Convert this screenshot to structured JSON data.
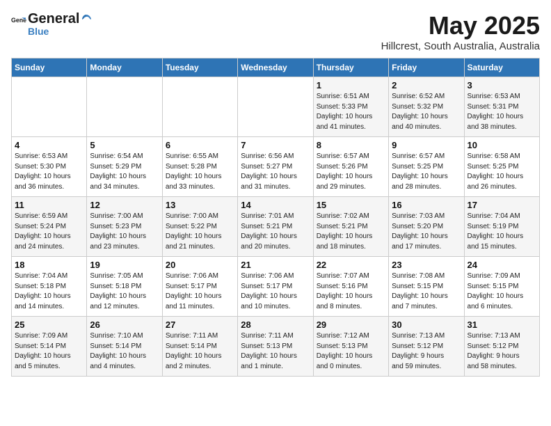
{
  "logo": {
    "text_general": "General",
    "text_blue": "Blue"
  },
  "header": {
    "month_title": "May 2025",
    "subtitle": "Hillcrest, South Australia, Australia"
  },
  "days_of_week": [
    "Sunday",
    "Monday",
    "Tuesday",
    "Wednesday",
    "Thursday",
    "Friday",
    "Saturday"
  ],
  "weeks": [
    [
      {
        "day": "",
        "info": ""
      },
      {
        "day": "",
        "info": ""
      },
      {
        "day": "",
        "info": ""
      },
      {
        "day": "",
        "info": ""
      },
      {
        "day": "1",
        "info": "Sunrise: 6:51 AM\nSunset: 5:33 PM\nDaylight: 10 hours\nand 41 minutes."
      },
      {
        "day": "2",
        "info": "Sunrise: 6:52 AM\nSunset: 5:32 PM\nDaylight: 10 hours\nand 40 minutes."
      },
      {
        "day": "3",
        "info": "Sunrise: 6:53 AM\nSunset: 5:31 PM\nDaylight: 10 hours\nand 38 minutes."
      }
    ],
    [
      {
        "day": "4",
        "info": "Sunrise: 6:53 AM\nSunset: 5:30 PM\nDaylight: 10 hours\nand 36 minutes."
      },
      {
        "day": "5",
        "info": "Sunrise: 6:54 AM\nSunset: 5:29 PM\nDaylight: 10 hours\nand 34 minutes."
      },
      {
        "day": "6",
        "info": "Sunrise: 6:55 AM\nSunset: 5:28 PM\nDaylight: 10 hours\nand 33 minutes."
      },
      {
        "day": "7",
        "info": "Sunrise: 6:56 AM\nSunset: 5:27 PM\nDaylight: 10 hours\nand 31 minutes."
      },
      {
        "day": "8",
        "info": "Sunrise: 6:57 AM\nSunset: 5:26 PM\nDaylight: 10 hours\nand 29 minutes."
      },
      {
        "day": "9",
        "info": "Sunrise: 6:57 AM\nSunset: 5:25 PM\nDaylight: 10 hours\nand 28 minutes."
      },
      {
        "day": "10",
        "info": "Sunrise: 6:58 AM\nSunset: 5:25 PM\nDaylight: 10 hours\nand 26 minutes."
      }
    ],
    [
      {
        "day": "11",
        "info": "Sunrise: 6:59 AM\nSunset: 5:24 PM\nDaylight: 10 hours\nand 24 minutes."
      },
      {
        "day": "12",
        "info": "Sunrise: 7:00 AM\nSunset: 5:23 PM\nDaylight: 10 hours\nand 23 minutes."
      },
      {
        "day": "13",
        "info": "Sunrise: 7:00 AM\nSunset: 5:22 PM\nDaylight: 10 hours\nand 21 minutes."
      },
      {
        "day": "14",
        "info": "Sunrise: 7:01 AM\nSunset: 5:21 PM\nDaylight: 10 hours\nand 20 minutes."
      },
      {
        "day": "15",
        "info": "Sunrise: 7:02 AM\nSunset: 5:21 PM\nDaylight: 10 hours\nand 18 minutes."
      },
      {
        "day": "16",
        "info": "Sunrise: 7:03 AM\nSunset: 5:20 PM\nDaylight: 10 hours\nand 17 minutes."
      },
      {
        "day": "17",
        "info": "Sunrise: 7:04 AM\nSunset: 5:19 PM\nDaylight: 10 hours\nand 15 minutes."
      }
    ],
    [
      {
        "day": "18",
        "info": "Sunrise: 7:04 AM\nSunset: 5:18 PM\nDaylight: 10 hours\nand 14 minutes."
      },
      {
        "day": "19",
        "info": "Sunrise: 7:05 AM\nSunset: 5:18 PM\nDaylight: 10 hours\nand 12 minutes."
      },
      {
        "day": "20",
        "info": "Sunrise: 7:06 AM\nSunset: 5:17 PM\nDaylight: 10 hours\nand 11 minutes."
      },
      {
        "day": "21",
        "info": "Sunrise: 7:06 AM\nSunset: 5:17 PM\nDaylight: 10 hours\nand 10 minutes."
      },
      {
        "day": "22",
        "info": "Sunrise: 7:07 AM\nSunset: 5:16 PM\nDaylight: 10 hours\nand 8 minutes."
      },
      {
        "day": "23",
        "info": "Sunrise: 7:08 AM\nSunset: 5:15 PM\nDaylight: 10 hours\nand 7 minutes."
      },
      {
        "day": "24",
        "info": "Sunrise: 7:09 AM\nSunset: 5:15 PM\nDaylight: 10 hours\nand 6 minutes."
      }
    ],
    [
      {
        "day": "25",
        "info": "Sunrise: 7:09 AM\nSunset: 5:14 PM\nDaylight: 10 hours\nand 5 minutes."
      },
      {
        "day": "26",
        "info": "Sunrise: 7:10 AM\nSunset: 5:14 PM\nDaylight: 10 hours\nand 4 minutes."
      },
      {
        "day": "27",
        "info": "Sunrise: 7:11 AM\nSunset: 5:14 PM\nDaylight: 10 hours\nand 2 minutes."
      },
      {
        "day": "28",
        "info": "Sunrise: 7:11 AM\nSunset: 5:13 PM\nDaylight: 10 hours\nand 1 minute."
      },
      {
        "day": "29",
        "info": "Sunrise: 7:12 AM\nSunset: 5:13 PM\nDaylight: 10 hours\nand 0 minutes."
      },
      {
        "day": "30",
        "info": "Sunrise: 7:13 AM\nSunset: 5:12 PM\nDaylight: 9 hours\nand 59 minutes."
      },
      {
        "day": "31",
        "info": "Sunrise: 7:13 AM\nSunset: 5:12 PM\nDaylight: 9 hours\nand 58 minutes."
      }
    ]
  ]
}
